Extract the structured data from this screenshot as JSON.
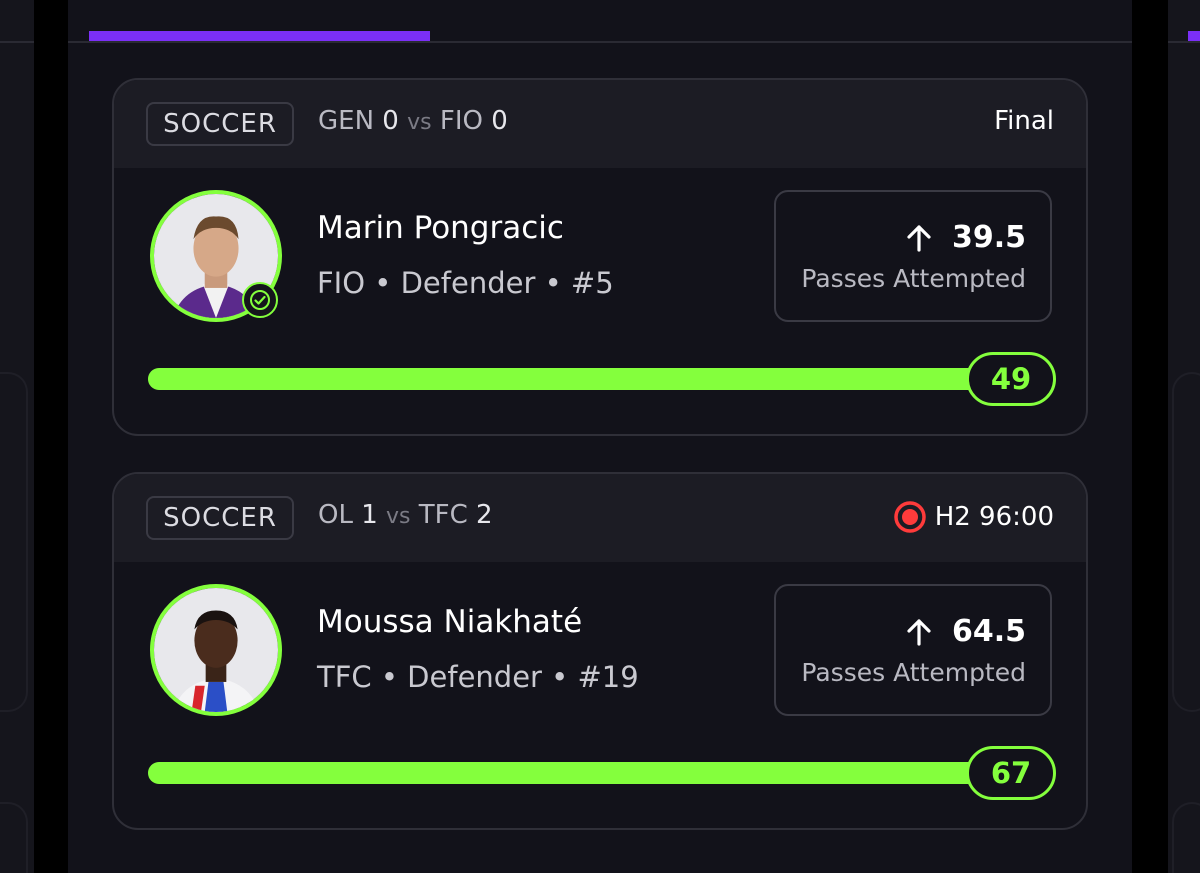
{
  "colors": {
    "accent_purple": "#7b2ff7",
    "progress_green": "#84ff3d",
    "live_red": "#ff3b3b"
  },
  "cards": [
    {
      "sport": "SOCCER",
      "home_team": "GEN",
      "home_score": "0",
      "vs": "vs",
      "away_team": "FIO",
      "away_score": "0",
      "status": "Final",
      "live": false,
      "player_name": "Marin Pongracic",
      "player_meta": "FIO • Defender • #5",
      "verified": true,
      "avatar_icon": "player-avatar-icon",
      "direction_icon": "arrow-up-icon",
      "line": "39.5",
      "stat": "Passes Attempted",
      "result": "49",
      "progress": 1.0
    },
    {
      "sport": "SOCCER",
      "home_team": "OL",
      "home_score": "1",
      "vs": "vs",
      "away_team": "TFC",
      "away_score": "2",
      "status": "H2 96:00",
      "live": true,
      "player_name": "Moussa Niakhaté",
      "player_meta": "TFC • Defender • #19",
      "verified": false,
      "avatar_icon": "player-avatar-icon",
      "direction_icon": "arrow-up-icon",
      "line": "64.5",
      "stat": "Passes Attempted",
      "result": "67",
      "progress": 1.0
    }
  ]
}
